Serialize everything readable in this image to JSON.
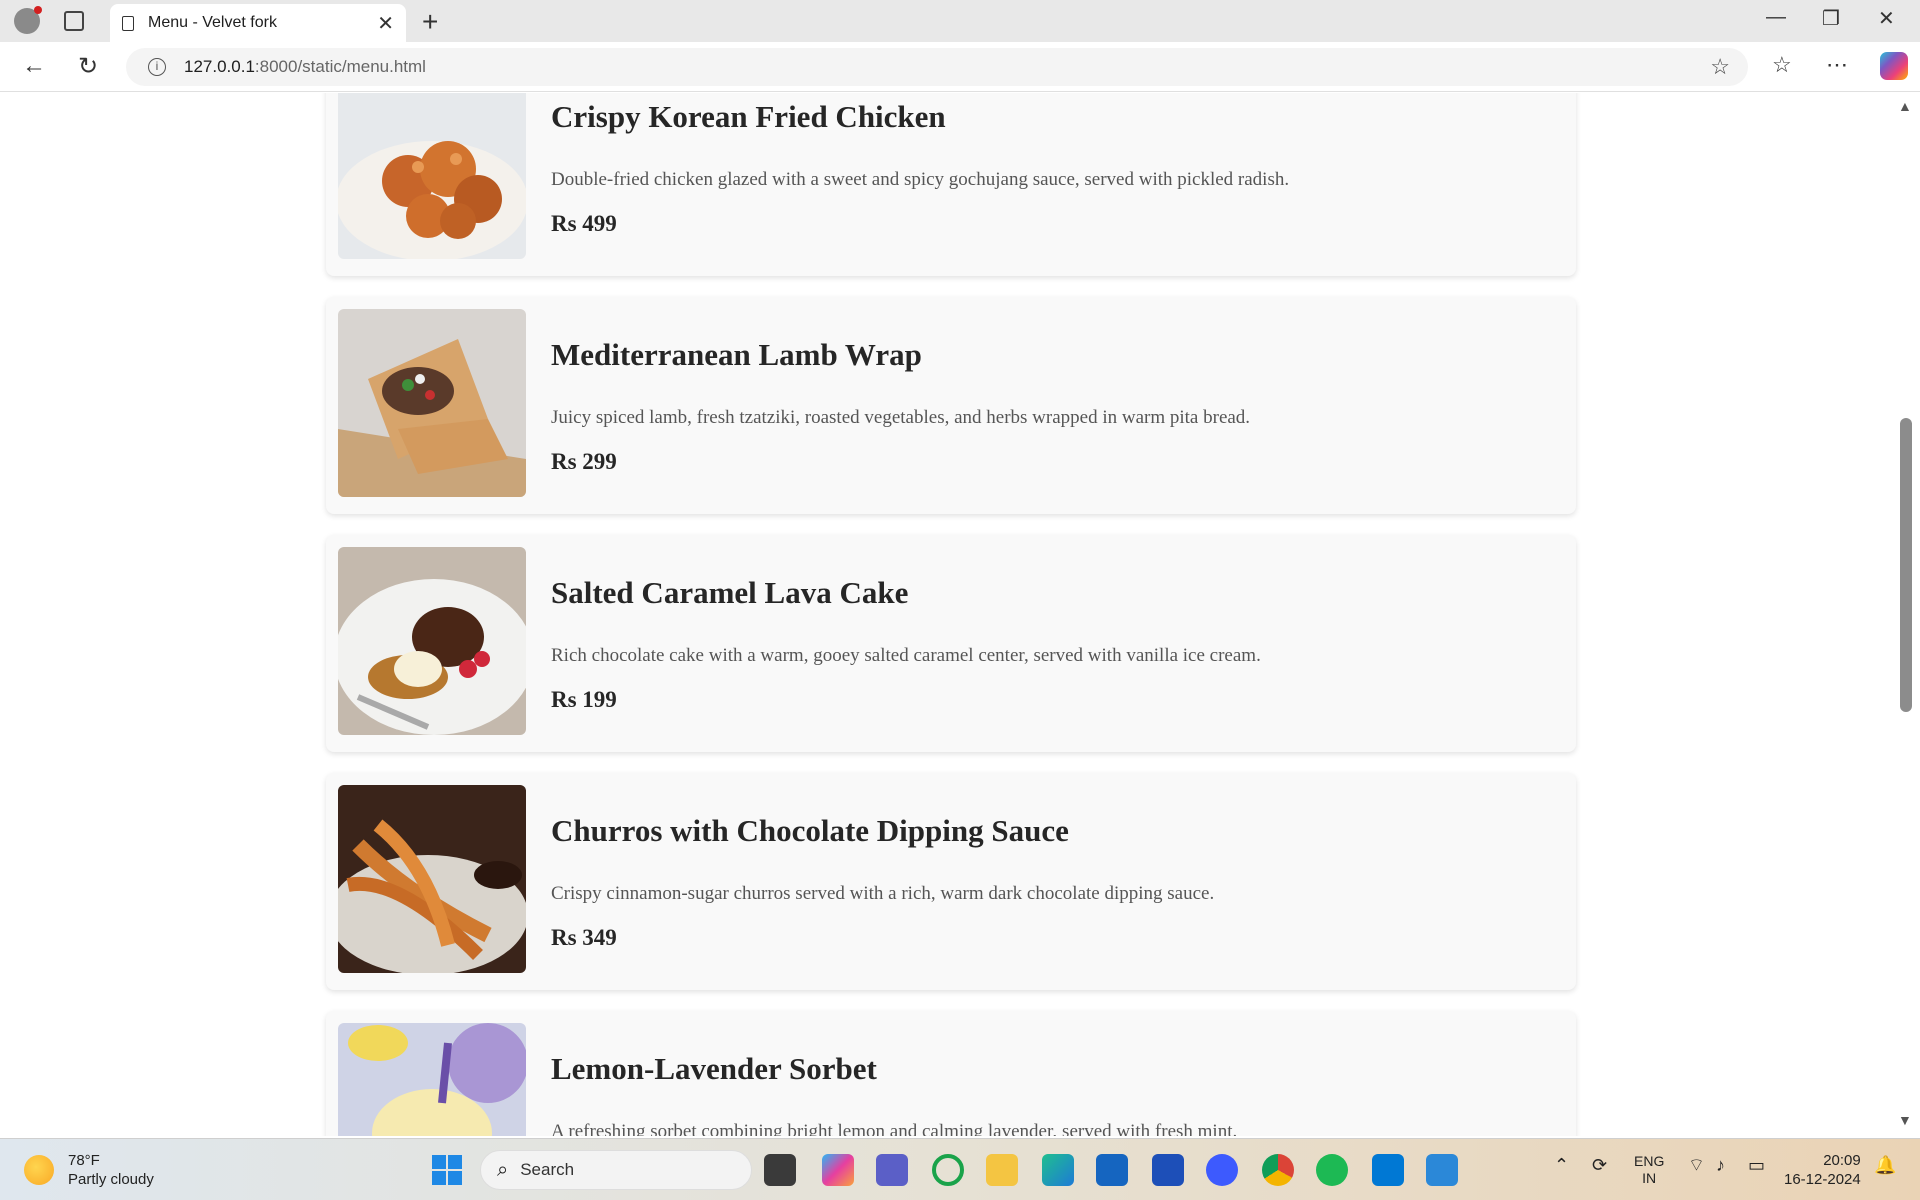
{
  "browser": {
    "tab_title": "Menu - Velvet fork",
    "url_host": "127.0.0.1",
    "url_rest": ":8000/static/menu.html"
  },
  "menu": {
    "items": [
      {
        "name": "Crispy Korean Fried Chicken",
        "description": "Double-fried chicken glazed with a sweet and spicy gochujang sauce, served with pickled radish.",
        "price": "Rs 499",
        "image": "fried-chicken"
      },
      {
        "name": "Mediterranean Lamb Wrap",
        "description": "Juicy spiced lamb, fresh tzatziki, roasted vegetables, and herbs wrapped in warm pita bread.",
        "price": "Rs 299",
        "image": "lamb-wrap"
      },
      {
        "name": "Salted Caramel Lava Cake",
        "description": "Rich chocolate cake with a warm, gooey salted caramel center, served with vanilla ice cream.",
        "price": "Rs 199",
        "image": "lava-cake"
      },
      {
        "name": "Churros with Chocolate Dipping Sauce",
        "description": "Crispy cinnamon-sugar churros served with a rich, warm dark chocolate dipping sauce.",
        "price": "Rs 349",
        "image": "churros"
      },
      {
        "name": "Lemon-Lavender Sorbet",
        "description": "A refreshing sorbet combining bright lemon and calming lavender, served with fresh mint.",
        "price": "",
        "image": "sorbet"
      }
    ]
  },
  "taskbar": {
    "temperature": "78°F",
    "weather": "Partly cloudy",
    "search_placeholder": "Search",
    "lang": "ENG",
    "region": "IN",
    "time": "20:09",
    "date": "16-12-2024"
  }
}
